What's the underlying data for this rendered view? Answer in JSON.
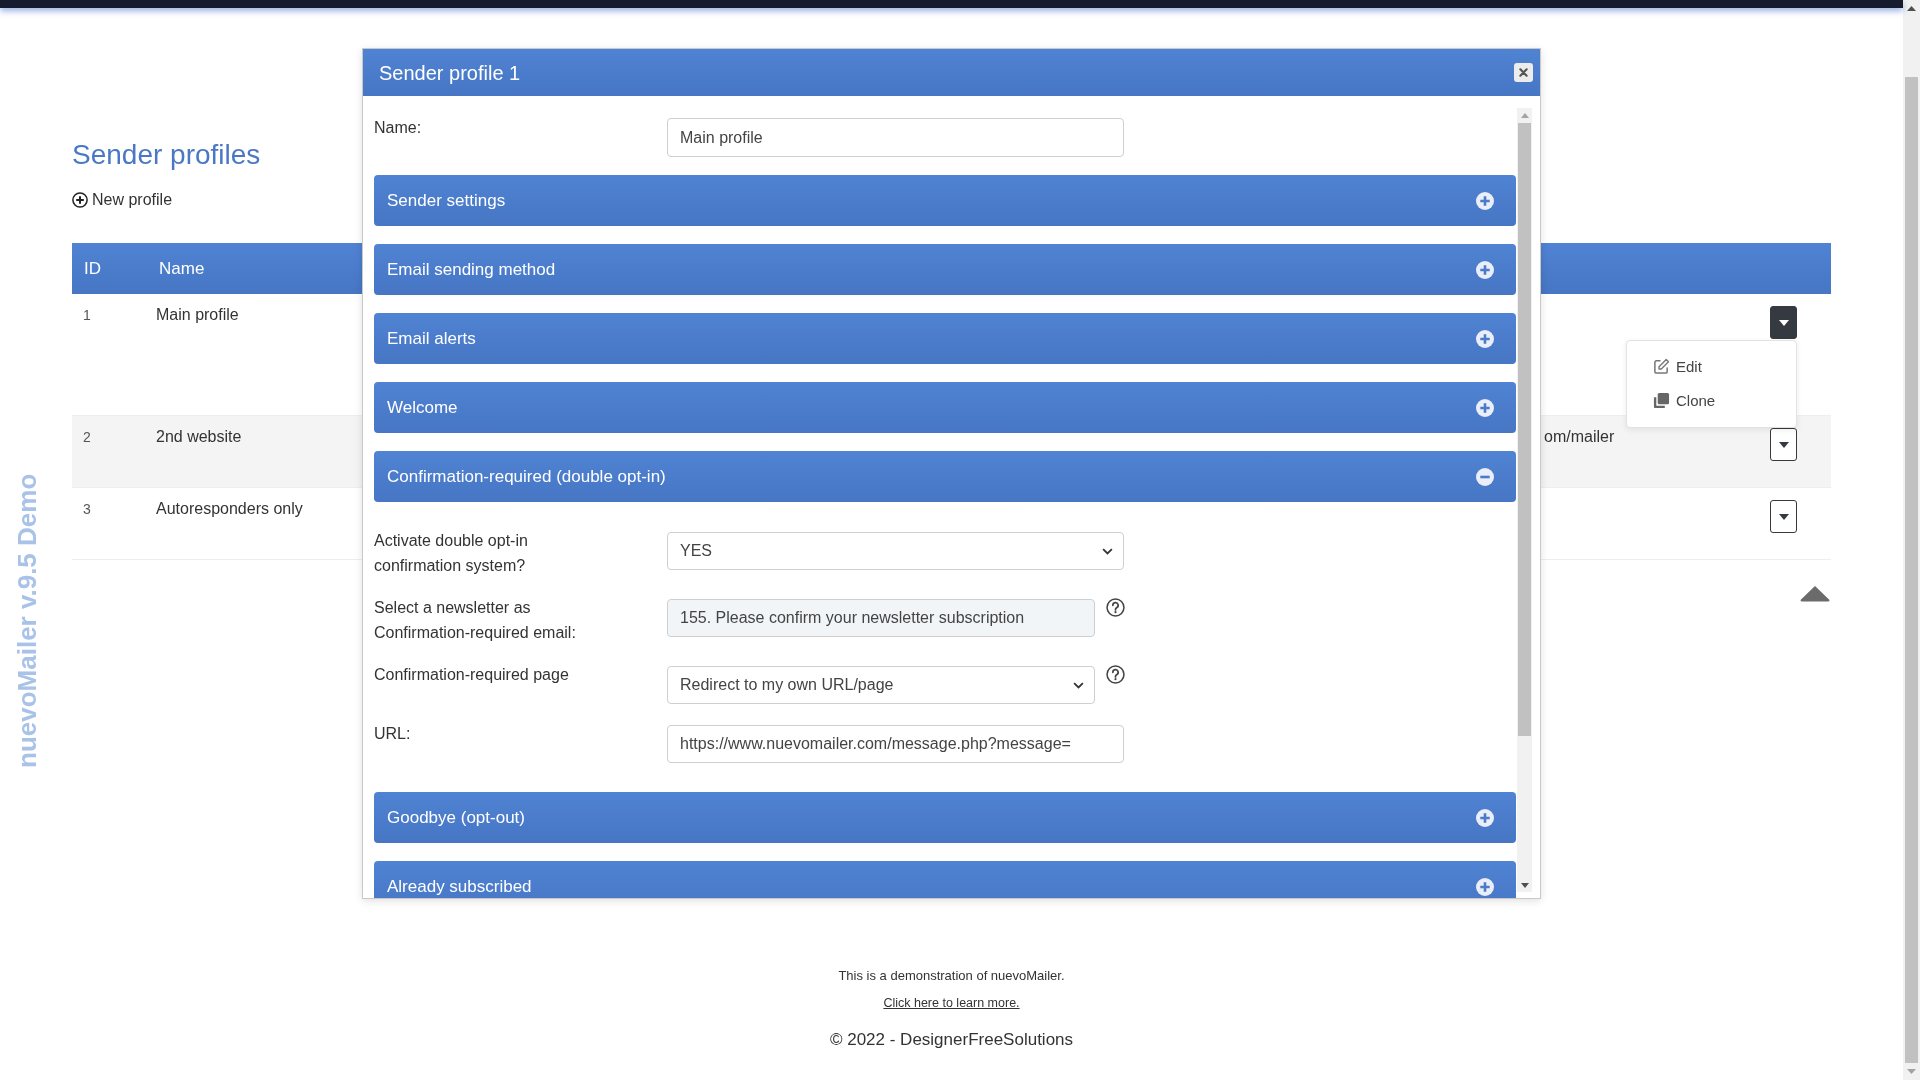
{
  "demo_label": "nuevoMailer v.9.5 Demo",
  "page": {
    "title": "Sender profiles",
    "new_profile": "New profile"
  },
  "table": {
    "columns": [
      "ID",
      "Name"
    ],
    "rows": [
      {
        "id": "1",
        "name": "Main profile",
        "menu_open": true
      },
      {
        "id": "2",
        "name": "2nd website",
        "column_3": "om/mailer",
        "menu_open": false
      },
      {
        "id": "3",
        "name": "Autoresponders only",
        "menu_open": false
      }
    ],
    "row_menu": [
      {
        "kind": "edit",
        "label": "Edit"
      },
      {
        "kind": "clone",
        "label": "Clone"
      }
    ]
  },
  "modal": {
    "title": "Sender profile 1",
    "name_field": {
      "label": "Name:",
      "value": "Main profile"
    },
    "sections": [
      {
        "title": "Sender settings",
        "expanded": false
      },
      {
        "title": "Email sending method",
        "expanded": false
      },
      {
        "title": "Email alerts",
        "expanded": false
      },
      {
        "title": "Welcome",
        "expanded": false
      },
      {
        "title": "Confirmation-required (double opt-in)",
        "expanded": true,
        "fields": [
          {
            "label": "Activate double opt-in confirmation system?",
            "kind": "select",
            "value": "YES",
            "help": false
          },
          {
            "label": "Select a newsletter as Confirmation-required email:",
            "kind": "readonly",
            "value": "155. Please confirm your newsletter subscription",
            "help": true
          },
          {
            "label": "Confirmation-required page",
            "kind": "select",
            "value": "Redirect to my own URL/page",
            "help": true
          },
          {
            "label": "URL:",
            "kind": "text",
            "value": "https://www.nuevomailer.com/message.php?message=",
            "help": false
          }
        ]
      },
      {
        "title": "Goodbye (opt-out)",
        "expanded": false
      },
      {
        "title": "Already subscribed",
        "expanded": false
      }
    ]
  },
  "footer": {
    "demo_text": "This is a demonstration of nuevoMailer.",
    "link": "Click here to learn more.",
    "copyright": "© 2022 - DesignerFreeSolutions"
  }
}
